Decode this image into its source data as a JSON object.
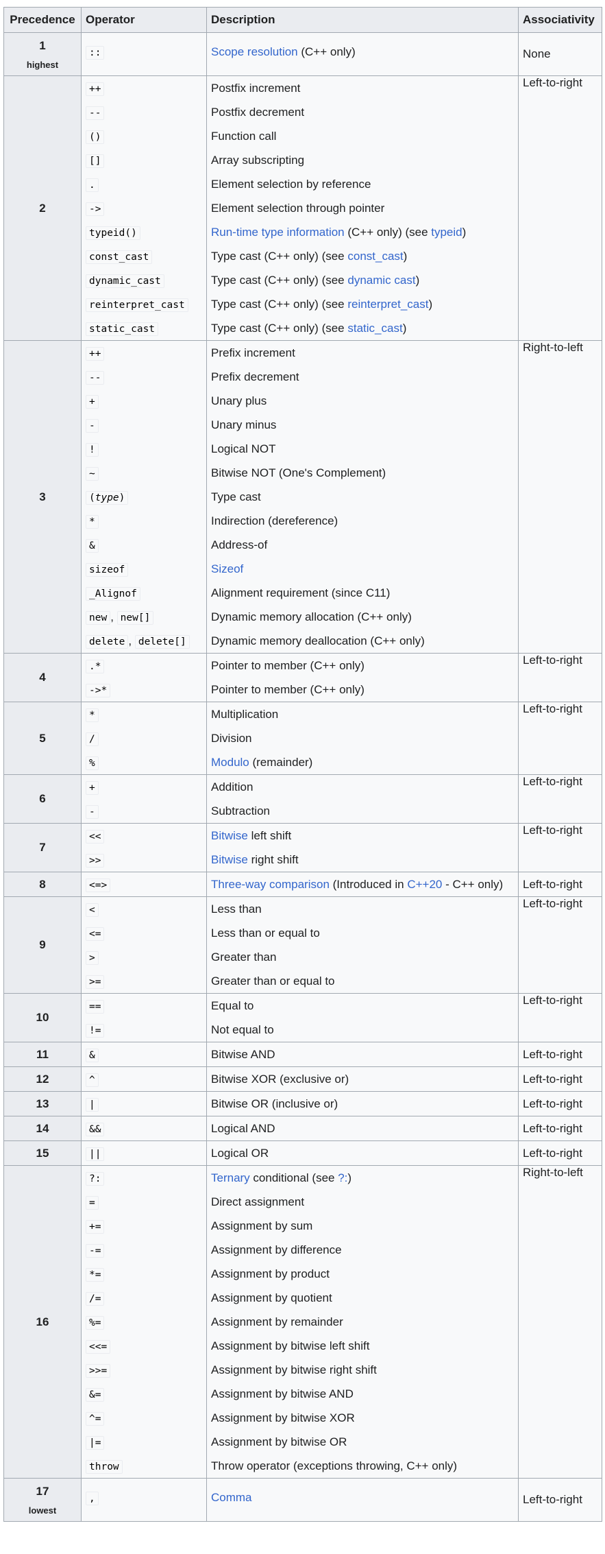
{
  "headers": {
    "precedence": "Precedence",
    "operator": "Operator",
    "description": "Description",
    "associativity": "Associativity"
  },
  "rows": [
    {
      "prec": "1",
      "sub": "highest",
      "assoc": "None",
      "ops": [
        [
          "::"
        ]
      ],
      "descs": [
        [
          {
            "t": "Scope resolution",
            "l": 1
          },
          {
            "t": " (C++ only)"
          }
        ]
      ]
    },
    {
      "prec": "2",
      "assoc": "Left-to-right",
      "ops": [
        [
          "++"
        ],
        [
          "--"
        ],
        [
          "()"
        ],
        [
          "[]"
        ],
        [
          "."
        ],
        [
          "->"
        ],
        [
          "typeid()"
        ],
        [
          "const_cast"
        ],
        [
          "dynamic_cast"
        ],
        [
          "reinterpret_cast"
        ],
        [
          "static_cast"
        ]
      ],
      "descs": [
        [
          {
            "t": "Postfix increment"
          }
        ],
        [
          {
            "t": "Postfix decrement"
          }
        ],
        [
          {
            "t": "Function call"
          }
        ],
        [
          {
            "t": "Array subscripting"
          }
        ],
        [
          {
            "t": "Element selection by reference"
          }
        ],
        [
          {
            "t": "Element selection through pointer"
          }
        ],
        [
          {
            "t": "Run-time type information",
            "l": 1
          },
          {
            "t": " (C++ only) (see "
          },
          {
            "t": "typeid",
            "l": 1
          },
          {
            "t": ")"
          }
        ],
        [
          {
            "t": "Type cast (C++ only) (see "
          },
          {
            "t": "const_cast",
            "l": 1
          },
          {
            "t": ")"
          }
        ],
        [
          {
            "t": "Type cast (C++ only) (see "
          },
          {
            "t": "dynamic cast",
            "l": 1
          },
          {
            "t": ")"
          }
        ],
        [
          {
            "t": "Type cast (C++ only) (see "
          },
          {
            "t": "reinterpret_cast",
            "l": 1
          },
          {
            "t": ")"
          }
        ],
        [
          {
            "t": "Type cast (C++ only) (see "
          },
          {
            "t": "static_cast",
            "l": 1
          },
          {
            "t": ")"
          }
        ]
      ]
    },
    {
      "prec": "3",
      "assoc": "Right-to-left",
      "ops": [
        [
          "++"
        ],
        [
          "--"
        ],
        [
          "+"
        ],
        [
          "-"
        ],
        [
          "!"
        ],
        [
          "~"
        ],
        [
          "(type)"
        ],
        [
          "*"
        ],
        [
          "&"
        ],
        [
          "sizeof"
        ],
        [
          "_Alignof"
        ],
        [
          "new",
          "new[]"
        ],
        [
          "delete",
          "delete[]"
        ]
      ],
      "descs": [
        [
          {
            "t": "Prefix increment"
          }
        ],
        [
          {
            "t": "Prefix decrement"
          }
        ],
        [
          {
            "t": "Unary plus"
          }
        ],
        [
          {
            "t": "Unary minus"
          }
        ],
        [
          {
            "t": "Logical NOT"
          }
        ],
        [
          {
            "t": "Bitwise NOT (One's Complement)"
          }
        ],
        [
          {
            "t": "Type cast"
          }
        ],
        [
          {
            "t": "Indirection (dereference)"
          }
        ],
        [
          {
            "t": "Address-of"
          }
        ],
        [
          {
            "t": "Sizeof",
            "l": 1
          }
        ],
        [
          {
            "t": "Alignment requirement (since C11)"
          }
        ],
        [
          {
            "t": "Dynamic memory allocation (C++ only)"
          }
        ],
        [
          {
            "t": "Dynamic memory deallocation (C++ only)"
          }
        ]
      ]
    },
    {
      "prec": "4",
      "assoc": "Left-to-right",
      "ops": [
        [
          ".*"
        ],
        [
          "->*"
        ]
      ],
      "descs": [
        [
          {
            "t": "Pointer to member (C++ only)"
          }
        ],
        [
          {
            "t": "Pointer to member (C++ only)"
          }
        ]
      ]
    },
    {
      "prec": "5",
      "assoc": "Left-to-right",
      "ops": [
        [
          "*"
        ],
        [
          "/"
        ],
        [
          "%"
        ]
      ],
      "descs": [
        [
          {
            "t": "Multiplication"
          }
        ],
        [
          {
            "t": "Division"
          }
        ],
        [
          {
            "t": "Modulo",
            "l": 1
          },
          {
            "t": " (remainder)"
          }
        ]
      ]
    },
    {
      "prec": "6",
      "assoc": "Left-to-right",
      "ops": [
        [
          "+"
        ],
        [
          "-"
        ]
      ],
      "descs": [
        [
          {
            "t": "Addition"
          }
        ],
        [
          {
            "t": "Subtraction"
          }
        ]
      ]
    },
    {
      "prec": "7",
      "assoc": "Left-to-right",
      "ops": [
        [
          "<<"
        ],
        [
          ">>"
        ]
      ],
      "descs": [
        [
          {
            "t": "Bitwise",
            "l": 1
          },
          {
            "t": " left shift"
          }
        ],
        [
          {
            "t": "Bitwise",
            "l": 1
          },
          {
            "t": " right shift"
          }
        ]
      ]
    },
    {
      "prec": "8",
      "assoc": "Left-to-right",
      "ops": [
        [
          "<=>"
        ]
      ],
      "descs": [
        [
          {
            "t": "Three-way comparison",
            "l": 1
          },
          {
            "t": " (Introduced in "
          },
          {
            "t": "C++20",
            "l": 1
          },
          {
            "t": " - C++ only)"
          }
        ]
      ]
    },
    {
      "prec": "9",
      "assoc": "Left-to-right",
      "ops": [
        [
          "<"
        ],
        [
          "<="
        ],
        [
          ">"
        ],
        [
          ">="
        ]
      ],
      "descs": [
        [
          {
            "t": "Less than"
          }
        ],
        [
          {
            "t": "Less than or equal to"
          }
        ],
        [
          {
            "t": "Greater than"
          }
        ],
        [
          {
            "t": "Greater than or equal to"
          }
        ]
      ]
    },
    {
      "prec": "10",
      "assoc": "Left-to-right",
      "ops": [
        [
          "=="
        ],
        [
          "!="
        ]
      ],
      "descs": [
        [
          {
            "t": "Equal to"
          }
        ],
        [
          {
            "t": "Not equal to"
          }
        ]
      ]
    },
    {
      "prec": "11",
      "assoc": "Left-to-right",
      "ops": [
        [
          "&"
        ]
      ],
      "descs": [
        [
          {
            "t": "Bitwise AND"
          }
        ]
      ]
    },
    {
      "prec": "12",
      "assoc": "Left-to-right",
      "ops": [
        [
          "^"
        ]
      ],
      "descs": [
        [
          {
            "t": "Bitwise XOR (exclusive or)"
          }
        ]
      ]
    },
    {
      "prec": "13",
      "assoc": "Left-to-right",
      "ops": [
        [
          "|"
        ]
      ],
      "descs": [
        [
          {
            "t": "Bitwise OR (inclusive or)"
          }
        ]
      ]
    },
    {
      "prec": "14",
      "assoc": "Left-to-right",
      "ops": [
        [
          "&&"
        ]
      ],
      "descs": [
        [
          {
            "t": "Logical AND"
          }
        ]
      ]
    },
    {
      "prec": "15",
      "assoc": "Left-to-right",
      "ops": [
        [
          "||"
        ]
      ],
      "descs": [
        [
          {
            "t": "Logical OR"
          }
        ]
      ]
    },
    {
      "prec": "16",
      "assoc": "Right-to-left",
      "ops": [
        [
          "?:"
        ],
        [
          "="
        ],
        [
          "+="
        ],
        [
          "-="
        ],
        [
          "*="
        ],
        [
          "/="
        ],
        [
          "%="
        ],
        [
          "<<="
        ],
        [
          ">>="
        ],
        [
          "&="
        ],
        [
          "^="
        ],
        [
          "|="
        ],
        [
          "throw"
        ]
      ],
      "descs": [
        [
          {
            "t": "Ternary",
            "l": 1
          },
          {
            "t": " conditional (see "
          },
          {
            "t": "?:",
            "l": 1
          },
          {
            "t": ")"
          }
        ],
        [
          {
            "t": "Direct assignment"
          }
        ],
        [
          {
            "t": "Assignment by sum"
          }
        ],
        [
          {
            "t": "Assignment by difference"
          }
        ],
        [
          {
            "t": "Assignment by product"
          }
        ],
        [
          {
            "t": "Assignment by quotient"
          }
        ],
        [
          {
            "t": "Assignment by remainder"
          }
        ],
        [
          {
            "t": "Assignment by bitwise left shift"
          }
        ],
        [
          {
            "t": "Assignment by bitwise right shift"
          }
        ],
        [
          {
            "t": "Assignment by bitwise AND"
          }
        ],
        [
          {
            "t": "Assignment by bitwise XOR"
          }
        ],
        [
          {
            "t": "Assignment by bitwise OR"
          }
        ],
        [
          {
            "t": "Throw operator (exceptions throwing, C++ only)"
          }
        ]
      ]
    },
    {
      "prec": "17",
      "sub": "lowest",
      "assoc": "Left-to-right",
      "ops": [
        [
          ","
        ]
      ],
      "descs": [
        [
          {
            "t": "Comma",
            "l": 1
          }
        ]
      ]
    }
  ]
}
